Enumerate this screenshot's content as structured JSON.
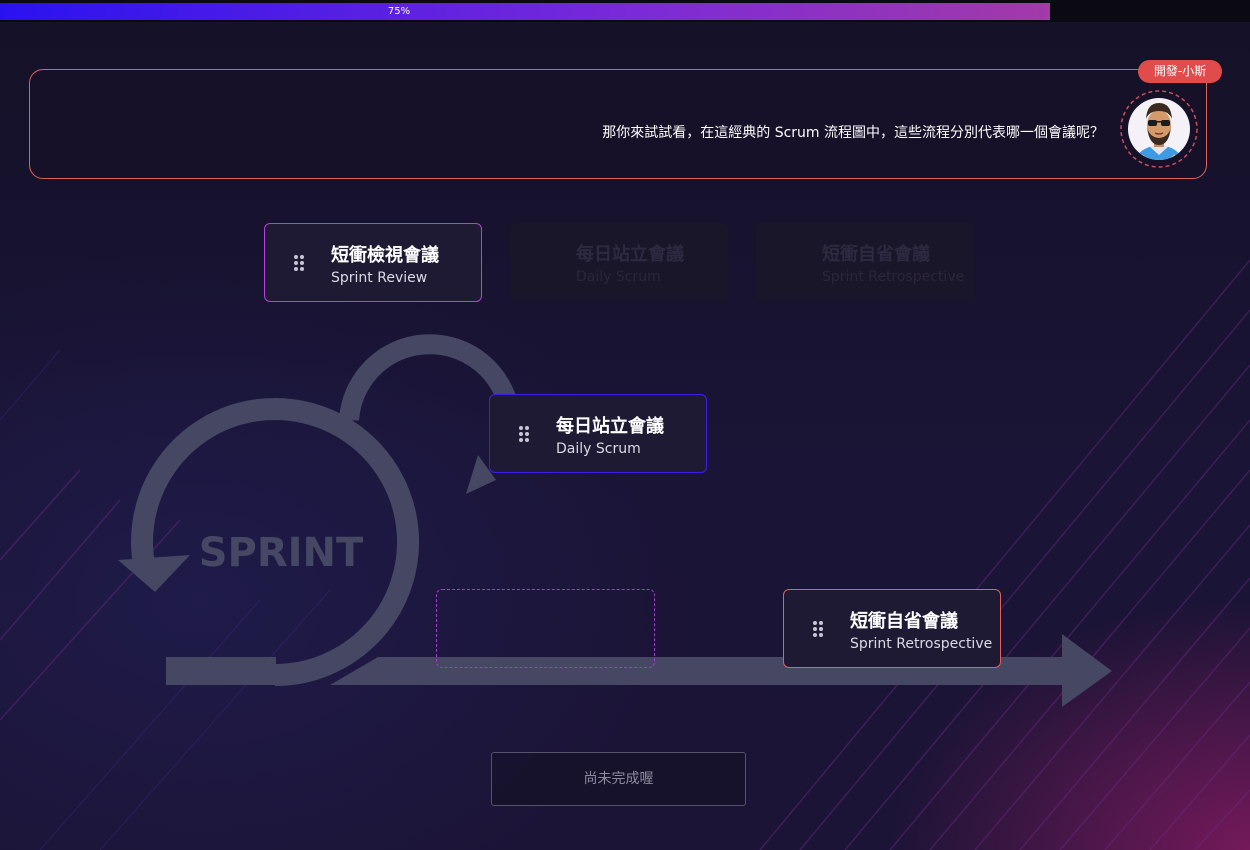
{
  "progress": {
    "value": 0.75,
    "label": "75%"
  },
  "dialog": {
    "speaker": "開發-小斯",
    "text": "那你來試試看，在這經典的 Scrum 流程圖中，這些流程分別代表哪一個會議呢？",
    "avatar_icon": "bearded-man-sunglasses-avatar"
  },
  "source_cards": [
    {
      "title": "短衝檢視會議",
      "subtitle": "Sprint Review",
      "state": "available",
      "border": "#b640d8"
    },
    {
      "title": "每日站立會議",
      "subtitle": "Daily Scrum",
      "state": "placed"
    },
    {
      "title": "短衝自省會議",
      "subtitle": "Sprint Retrospective",
      "state": "placed"
    }
  ],
  "diagram": {
    "label": "SPRINT",
    "color": "#454763"
  },
  "placed_cards": {
    "daily": {
      "title": "每日站立會議",
      "subtitle": "Daily Scrum",
      "border": "#3b1fe8"
    },
    "retro": {
      "title": "短衝自省會議",
      "subtitle": "Sprint Retrospective",
      "border": "#e3605c"
    }
  },
  "submit_button": {
    "label": "尚未完成喔"
  }
}
